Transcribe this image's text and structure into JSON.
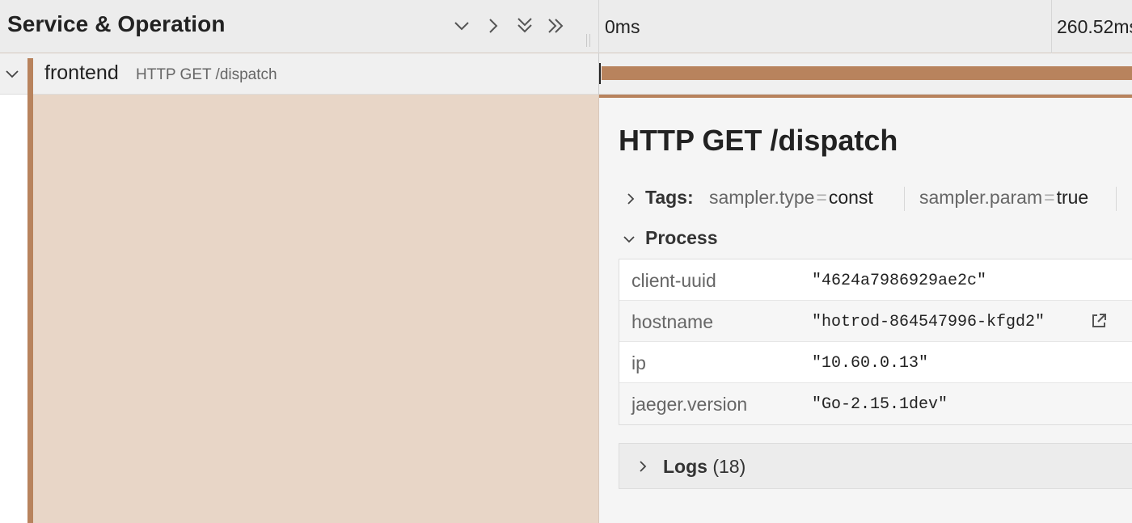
{
  "header": {
    "title": "Service & Operation",
    "timeline_ticks": [
      "0ms",
      "260.52ms"
    ],
    "icons": [
      "chevron-down-icon",
      "chevron-right-icon",
      "double-chevron-down-icon",
      "double-chevron-right-icon"
    ]
  },
  "span_row": {
    "service": "frontend",
    "operation": "HTTP GET /dispatch",
    "accent_color": "#b8835d"
  },
  "detail": {
    "title": "HTTP GET /dispatch",
    "tags": {
      "label": "Tags:",
      "items": [
        {
          "key": "sampler.type",
          "value": "const"
        },
        {
          "key": "sampler.param",
          "value": "true"
        }
      ]
    },
    "process": {
      "label": "Process",
      "rows": [
        {
          "key": "client-uuid",
          "value": "\"4624a7986929ae2c\""
        },
        {
          "key": "hostname",
          "value": "\"hotrod-864547996-kfgd2\""
        },
        {
          "key": "ip",
          "value": "\"10.60.0.13\""
        },
        {
          "key": "jaeger.version",
          "value": "\"Go-2.15.1dev\""
        }
      ]
    },
    "logs": {
      "label": "Logs",
      "count": "(18)"
    }
  },
  "colors": {
    "span_bar": "#b8835d",
    "left_fill": "#e8d6c7",
    "header_bg": "#ececec"
  }
}
